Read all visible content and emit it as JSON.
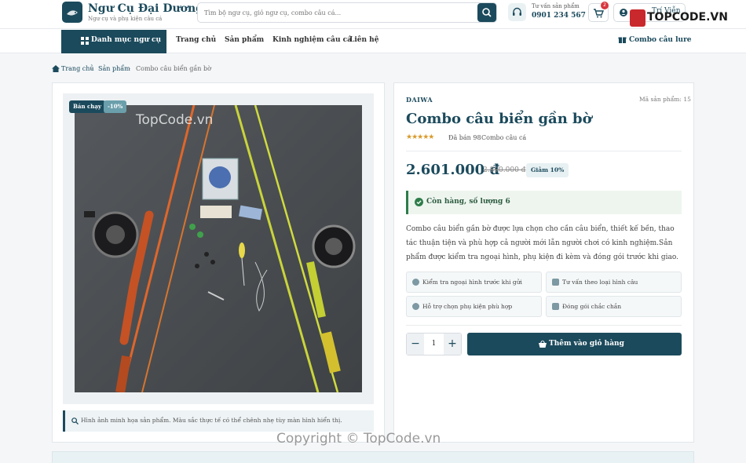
{
  "header": {
    "store_name": "Ngư Cụ Đại Dương",
    "tagline": "Ngư cụ và phụ kiện câu cá",
    "search_placeholder": "Tìm bộ ngư cụ, giỏ ngư cụ, combo câu cá...",
    "consult_label": "Tư vấn sản phẩm",
    "consult_phone": "0901 234 567",
    "cart_count": "2",
    "user_name": "Trí Viễn",
    "watermark_logo": "TOPCODE.VN"
  },
  "nav": {
    "category_button": "Danh mục ngư cụ",
    "links": [
      "Trang chủ",
      "Sản phẩm",
      "Kinh nghiệm câu cá",
      "Liên hệ"
    ],
    "combo_link": "Combo câu lure"
  },
  "breadcrumb": [
    "Trang chủ",
    "Sản phẩm",
    "Combo câu biển gần bờ"
  ],
  "gallery": {
    "badge_hot": "Bán chạy",
    "badge_discount": "-10%",
    "watermark": "TopCode.vn",
    "note": "Hình ảnh minh họa sản phẩm. Màu sắc thực tế có thể chênh nhẹ tùy màn hình hiển thị."
  },
  "product": {
    "brand": "DAIWA",
    "sku": "Mã sản phẩm: 15",
    "title": "Combo câu biển gần bờ",
    "stars": "★★★★★",
    "sold": "Đã bán 98",
    "category": "Combo câu cá",
    "price": "2.601.000 đ",
    "old_price": "2.890.000 đ",
    "discount": "Giảm 10%",
    "stock": "Còn hàng, số lượng 6",
    "description": "Combo câu biển gần bờ được lựa chọn cho cần câu biển, thiết kế bền, thao tác thuận tiện và phù hợp cả người mới lẫn người chơi có kinh nghiệm.Sản phẩm được kiểm tra ngoại hình, phụ kiện đi kèm và đóng gói trước khi giao.",
    "features": [
      "Kiểm tra ngoại hình trước khi gửi",
      "Tư vấn theo loại hình câu",
      "Hỗ trợ chọn phụ kiện phù hợp",
      "Đóng gói chắc chắn"
    ],
    "quantity": "1",
    "add_to_cart": "Thêm vào giỏ hàng"
  },
  "footer_watermark": "Copyright © TopCode.vn",
  "colors": {
    "primary": "#1b4a5c",
    "accent": "#6a9fab",
    "stock_green": "#2e7d4a",
    "star": "#d99a2b",
    "badge_red": "#d9363e"
  }
}
